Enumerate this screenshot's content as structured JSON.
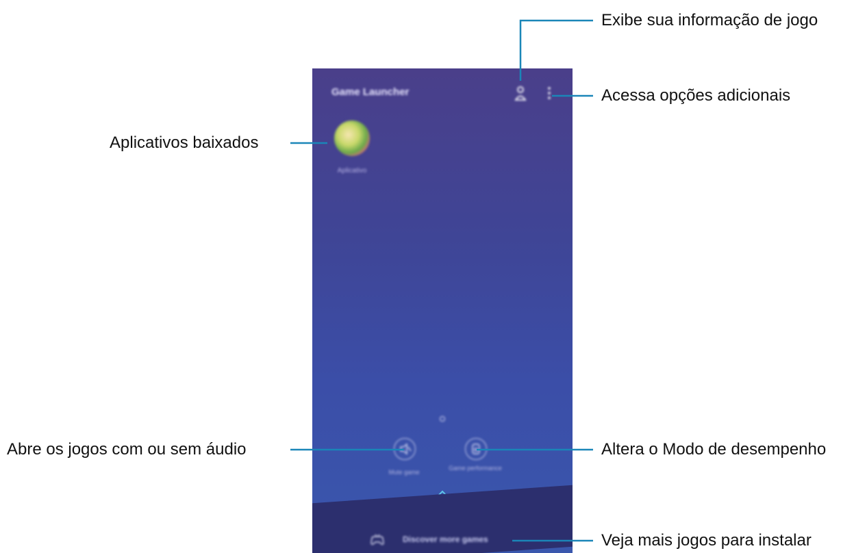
{
  "app": {
    "title": "Game Launcher",
    "game_name": "Aplicativo",
    "mute_label": "Mute game",
    "perf_label": "Game performance",
    "discover_label": "Discover more games"
  },
  "callouts": {
    "profile": "Exibe sua informação de jogo",
    "more_options": "Acessa opções adicionais",
    "downloaded_apps": "Aplicativos baixados",
    "audio": "Abre os jogos com ou sem áudio",
    "performance": "Altera o Modo de desempenho",
    "discover": "Veja mais jogos para instalar"
  },
  "colors": {
    "callout_line": "#1a86b8",
    "phone_top": "#4a3f8a",
    "phone_bottom": "#3a57ad",
    "bottom_bar": "#2c2f6e"
  },
  "icons": {
    "profile": "person-icon",
    "more": "more-vertical-icon",
    "mute": "speaker-muted-icon",
    "performance": "performance-icon",
    "expand": "double-chevron-up-icon",
    "discover": "gamepad-icon"
  }
}
